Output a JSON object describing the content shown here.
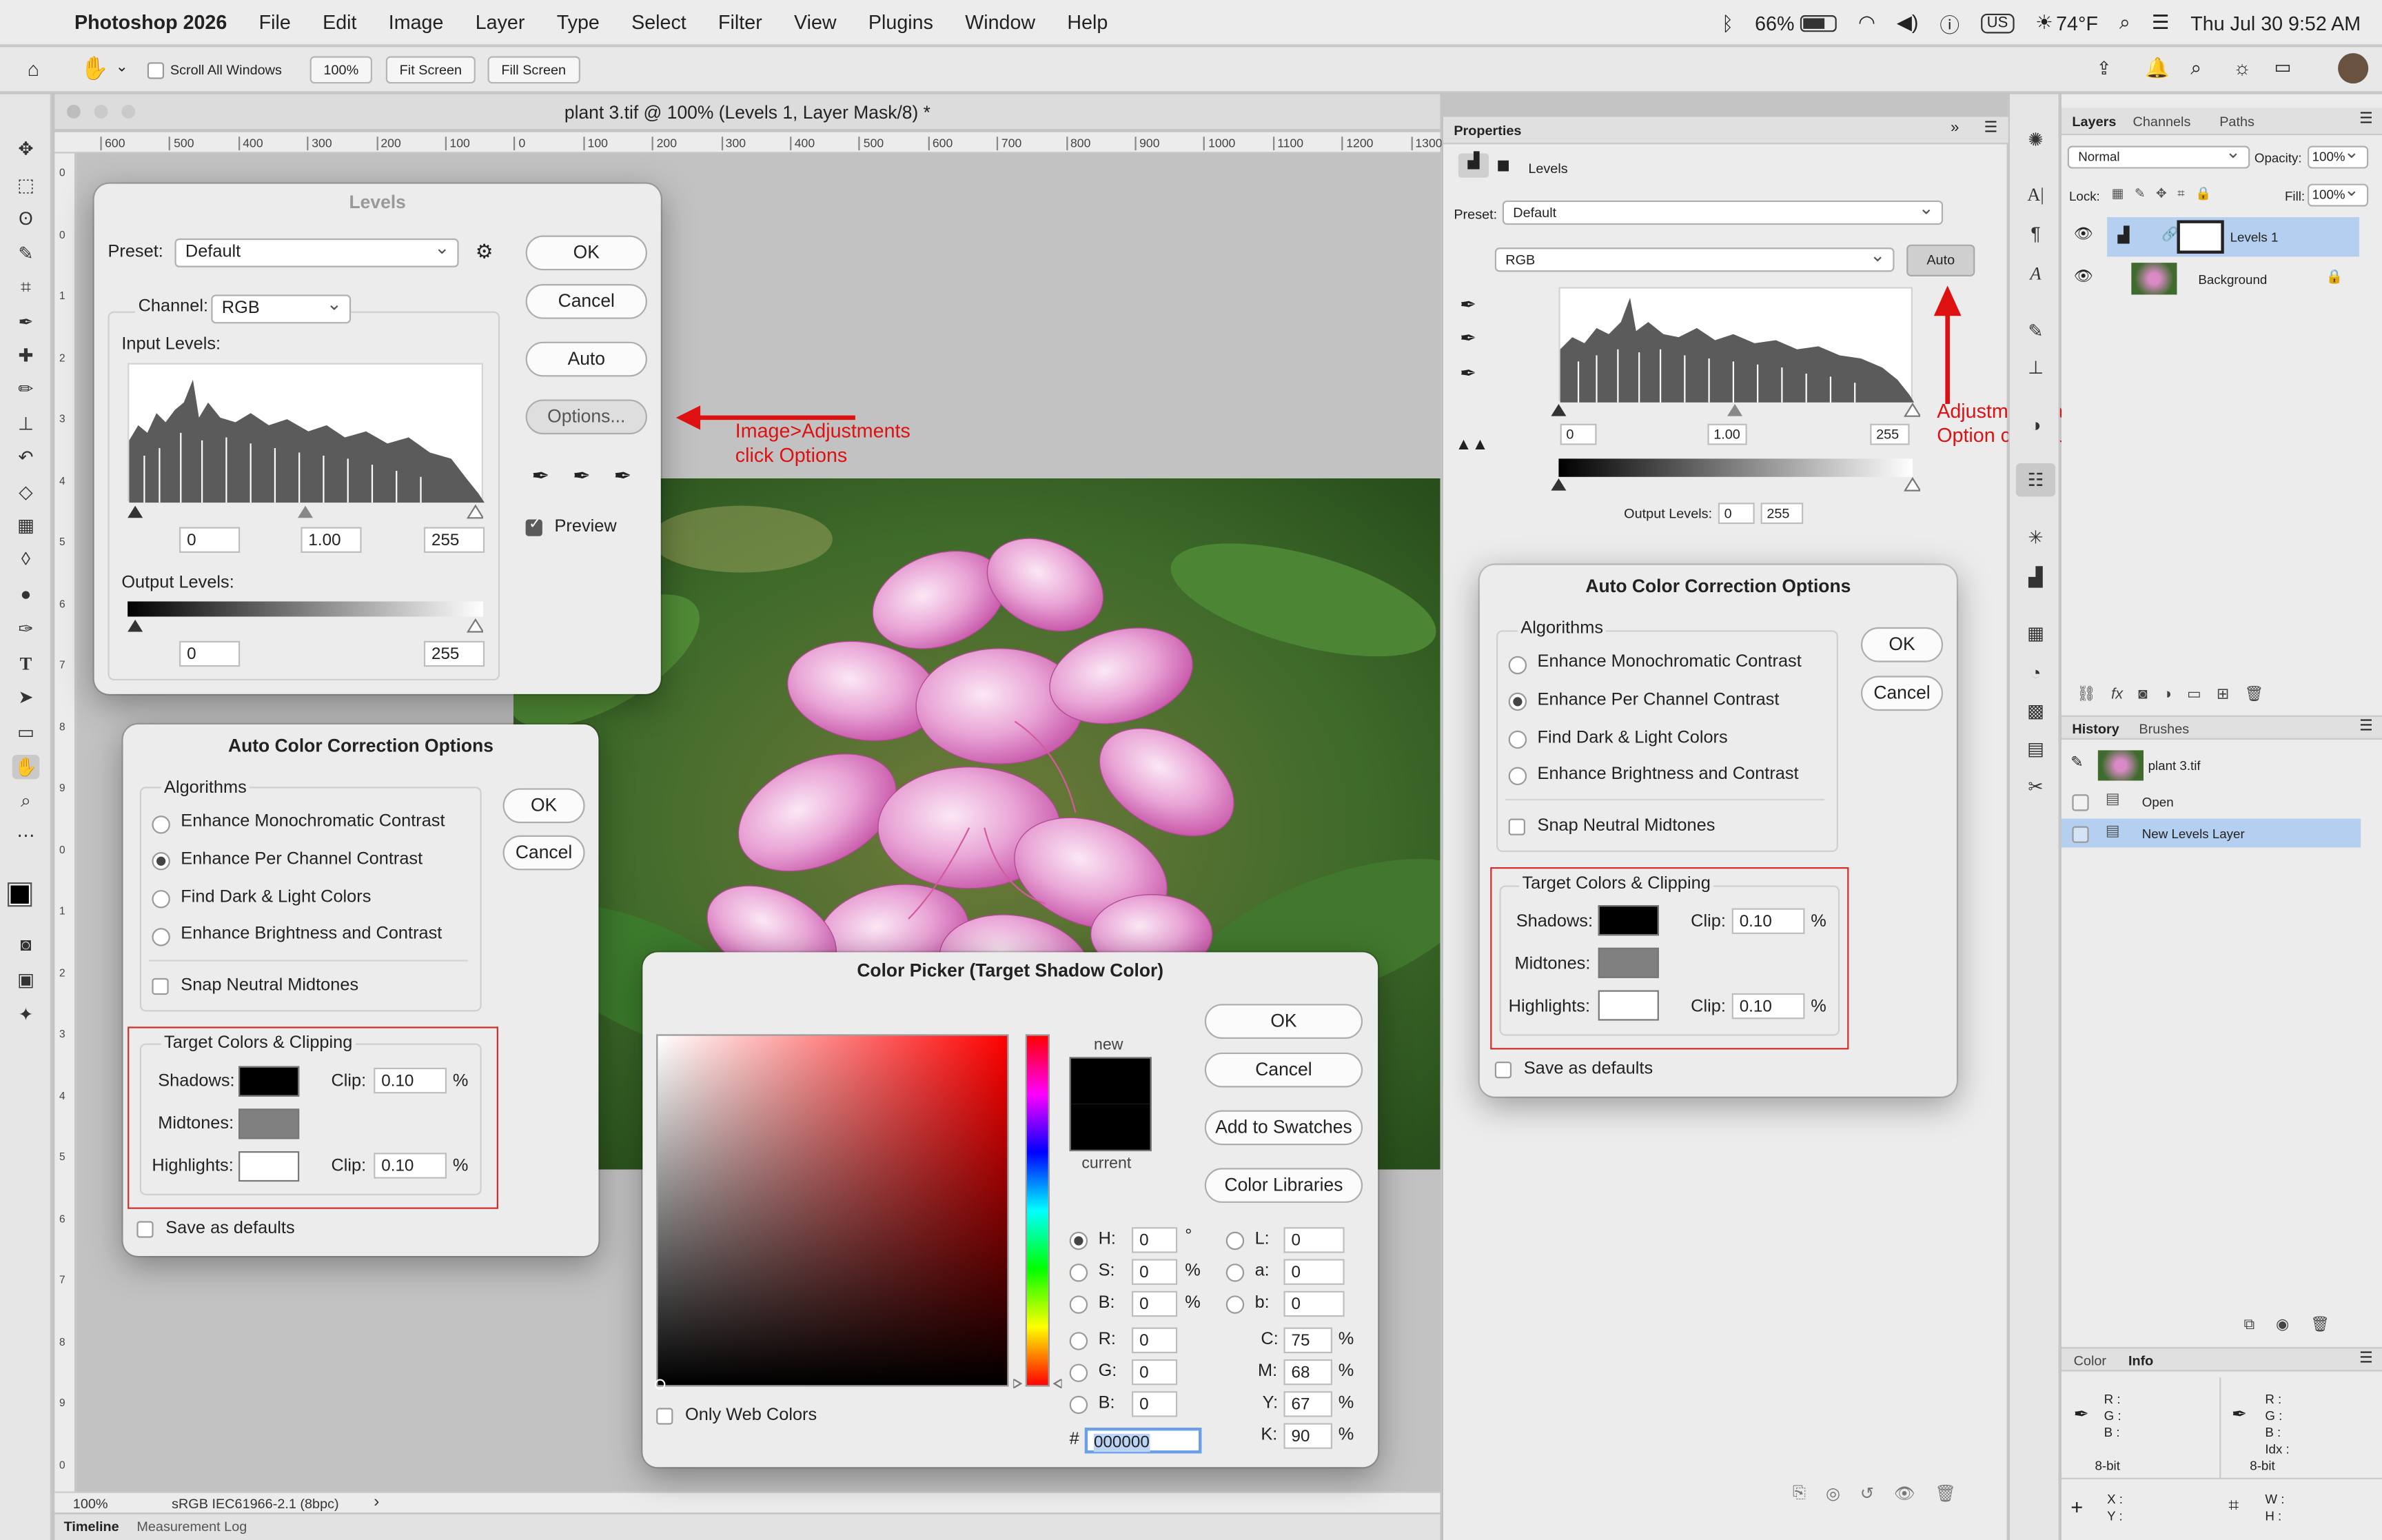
{
  "menubar": {
    "app_name": "Photoshop 2026",
    "items": [
      "File",
      "Edit",
      "Image",
      "Layer",
      "Type",
      "Select",
      "Filter",
      "View",
      "Plugins",
      "Window",
      "Help"
    ],
    "battery": "66%",
    "input_source": "US",
    "weather": "74°F",
    "datetime": "Thu Jul 30  9:52 AM"
  },
  "options_bar": {
    "scroll_all_label": "Scroll All Windows",
    "zoom_btn": "100%",
    "fit_screen": "Fit Screen",
    "fill_screen": "Fill Screen"
  },
  "document": {
    "title": "plant 3.tif @ 100% (Levels 1, Layer Mask/8) *",
    "ruler_h": [
      "600",
      "500",
      "400",
      "300",
      "200",
      "100",
      "0",
      "100",
      "200",
      "300",
      "400",
      "500",
      "600",
      "700",
      "800",
      "900",
      "1000",
      "1100",
      "1200",
      "1300"
    ],
    "ruler_v": [
      "0",
      "0",
      "1",
      "2",
      "3",
      "4",
      "5",
      "6",
      "7",
      "8",
      "9",
      "0",
      "1",
      "2",
      "3",
      "4",
      "5",
      "6",
      "7",
      "8",
      "9",
      "0"
    ],
    "zoom": "100%",
    "color_profile": "sRGB IEC61966-2.1 (8bpc)",
    "bottom_tabs": [
      "Timeline",
      "Measurement Log"
    ]
  },
  "levels_dialog": {
    "title": "Levels",
    "preset_label": "Preset:",
    "preset_value": "Default",
    "channel_label": "Channel:",
    "channel_value": "RGB",
    "input_levels_label": "Input Levels:",
    "input_black": "0",
    "input_gamma": "1.00",
    "input_white": "255",
    "output_levels_label": "Output Levels:",
    "output_black": "0",
    "output_white": "255",
    "buttons": {
      "ok": "OK",
      "cancel": "Cancel",
      "auto": "Auto",
      "options": "Options..."
    },
    "preview_label": "Preview"
  },
  "annotation_left": {
    "line1": "Image>Adjustments",
    "line2": "click Options"
  },
  "annotation_right": {
    "line1": "Adjustment Layers",
    "line2": "Option click Auto"
  },
  "acc_left": {
    "title": "Auto Color Correction Options",
    "algorithms_label": "Algorithms",
    "options": [
      "Enhance Monochromatic Contrast",
      "Enhance Per Channel Contrast",
      "Find Dark & Light Colors",
      "Enhance Brightness and Contrast"
    ],
    "selected_index": 1,
    "snap_label": "Snap Neutral Midtones",
    "target_label": "Target Colors & Clipping",
    "shadows_label": "Shadows:",
    "midtones_label": "Midtones:",
    "highlights_label": "Highlights:",
    "clip_label": "Clip:",
    "shadows_clip": "0.10",
    "highlights_clip": "0.10",
    "percent": "%",
    "save_defaults": "Save as defaults",
    "ok": "OK",
    "cancel": "Cancel"
  },
  "acc_right": {
    "title": "Auto Color Correction Options",
    "algorithms_label": "Algorithms",
    "options": [
      "Enhance Monochromatic Contrast",
      "Enhance Per Channel Contrast",
      "Find Dark & Light Colors",
      "Enhance Brightness and Contrast"
    ],
    "selected_index": 1,
    "snap_label": "Snap Neutral Midtones",
    "target_label": "Target Colors & Clipping",
    "shadows_label": "Shadows:",
    "midtones_label": "Midtones:",
    "highlights_label": "Highlights:",
    "clip_label": "Clip:",
    "shadows_clip": "0.10",
    "highlights_clip": "0.10",
    "percent": "%",
    "save_defaults": "Save as defaults",
    "ok": "OK",
    "cancel": "Cancel"
  },
  "color_picker": {
    "title": "Color Picker (Target Shadow Color)",
    "new_label": "new",
    "current_label": "current",
    "buttons": {
      "ok": "OK",
      "cancel": "Cancel",
      "swatches": "Add to Swatches",
      "libraries": "Color Libraries"
    },
    "only_web": "Only Web Colors",
    "H": "0",
    "S": "0",
    "B": "0",
    "R": "0",
    "G": "0",
    "Bb": "0",
    "L": "0",
    "a": "0",
    "b": "0",
    "C": "75",
    "M": "68",
    "Y": "67",
    "K": "90",
    "hex": "000000",
    "deg": "°",
    "pct": "%"
  },
  "properties": {
    "title": "Properties",
    "subtitle": "Levels",
    "preset_label": "Preset:",
    "preset_value": "Default",
    "channel_value": "RGB",
    "auto_btn": "Auto",
    "input_black": "0",
    "input_gamma": "1.00",
    "input_white": "255",
    "output_label": "Output Levels:",
    "output_black": "0",
    "output_white": "255"
  },
  "layers_panel": {
    "tabs": [
      "Layers",
      "Channels",
      "Paths"
    ],
    "blend_mode": "Normal",
    "opacity_label": "Opacity:",
    "opacity_value": "100%",
    "lock_label": "Lock:",
    "fill_label": "Fill:",
    "fill_value": "100%",
    "layers": [
      "Levels 1",
      "Background"
    ]
  },
  "history_panel": {
    "tabs": [
      "History",
      "Brushes"
    ],
    "snapshot": "plant 3.tif",
    "items": [
      "Open",
      "New Levels Layer"
    ]
  },
  "info_panel": {
    "tabs": [
      "Color",
      "Info"
    ],
    "rgb_labels": [
      "R :",
      "G :",
      "B :"
    ],
    "bit_depth": "8-bit",
    "idx_label": "Idx :",
    "x_label": "X :",
    "y_label": "Y :",
    "w_label": "W :",
    "h_label": "H :"
  },
  "colors": {
    "accent_red": "#d11f1f",
    "selection_blue": "#b5cff0"
  }
}
